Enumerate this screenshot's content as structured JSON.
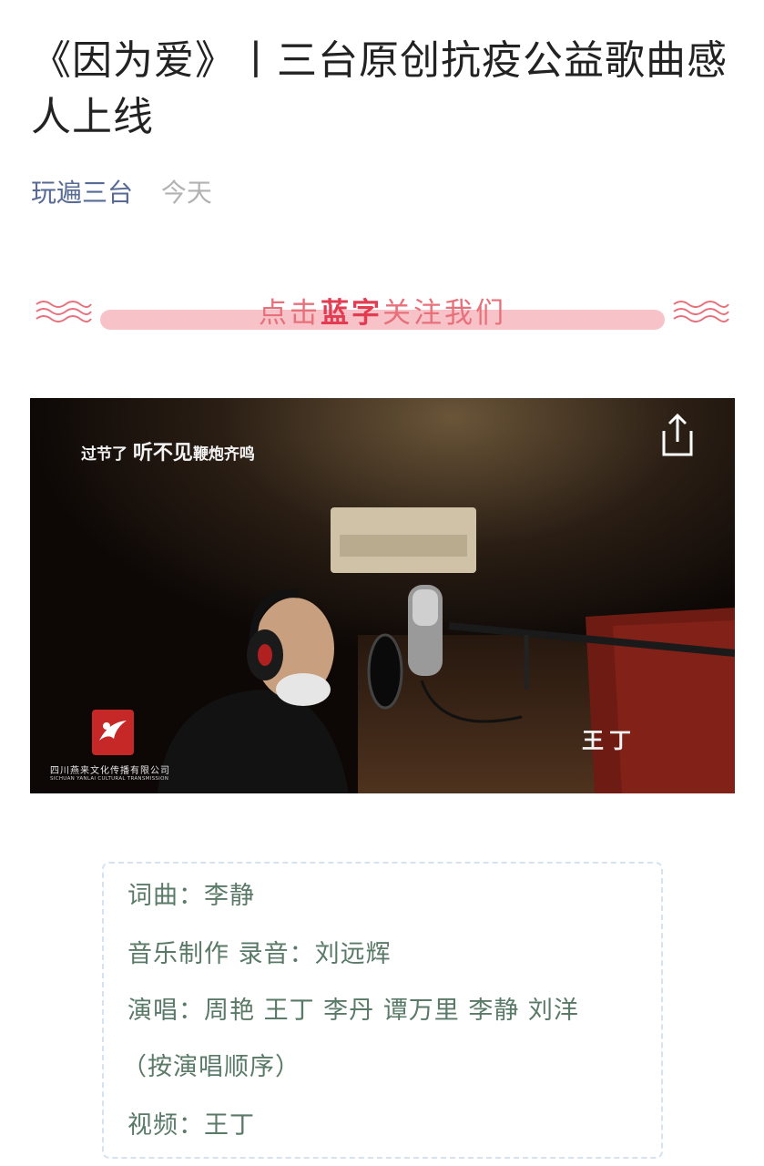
{
  "article": {
    "title": "《因为爱》丨三台原创抗疫公益歌曲感人上线",
    "account_name": "玩遍三台",
    "publish_date": "今天"
  },
  "follow_banner": {
    "prefix": "点击",
    "highlight": "蓝字",
    "suffix": "关注我们",
    "highlight_color": "#e23b52",
    "bar_color": "#f7c3c8",
    "icon": "wave-icon"
  },
  "video": {
    "caption_small": "过节了",
    "caption_big": "听不见",
    "caption_tail": "鞭炮齐鸣",
    "singer_label": "王丁",
    "share_icon": "share-icon",
    "company_cn": "四川燕来文化传播有限公司",
    "company_en": "SICHUAN YANLAI CULTURAL TRANSMISSION"
  },
  "credits": {
    "lines": [
      "词曲：李静",
      "音乐制作 录音：刘远辉",
      "演唱：周艳 王丁 李丹 谭万里 李静 刘洋",
      "（按演唱顺序）",
      "视频：王丁"
    ],
    "text_color": "#5a7a68",
    "border_color": "#d6e3ef"
  }
}
